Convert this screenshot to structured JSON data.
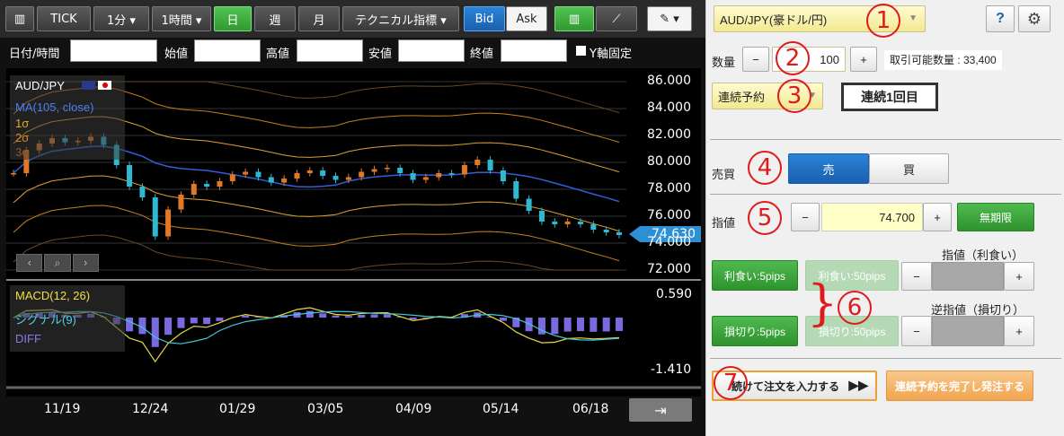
{
  "toolbar": {
    "tick": "TICK",
    "interval_1": "1分 ▾",
    "interval_2": "1時間 ▾",
    "day": "日",
    "week": "週",
    "month": "月",
    "technical": "テクニカル指標 ▾",
    "bid": "Bid",
    "ask": "Ask"
  },
  "fields": {
    "datetime": "日付/時間",
    "open": "始値",
    "high": "高値",
    "low": "安値",
    "close": "終値",
    "y_fixed": "Y軸固定"
  },
  "legend": {
    "symbol": "AUD/JPY",
    "ma": "MA(105, close)",
    "s1": "1σ",
    "s2": "2σ",
    "s3": "3σ",
    "macd": "MACD(12, 26)",
    "signal": "シグナル(9)",
    "diff": "DIFF"
  },
  "chart_data": {
    "type": "line",
    "y_ticks": [
      "86.000",
      "84.000",
      "82.000",
      "80.000",
      "78.000",
      "76.000",
      "74.000",
      "72.000"
    ],
    "macd_ticks": [
      "0.590",
      "-1.410"
    ],
    "x_ticks": [
      "11/19",
      "12/24",
      "01/29",
      "03/05",
      "04/09",
      "05/14",
      "06/18"
    ],
    "current_price": "74.630",
    "price_series": [
      79.2,
      80.9,
      81.4,
      81.8,
      81.5,
      81.6,
      81.9,
      81.3,
      79.8,
      78.2,
      77.4,
      74.5,
      76.5,
      77.6,
      78.4,
      78.2,
      78.6,
      79.1,
      79.3,
      78.9,
      78.5,
      78.8,
      79.2,
      79.4,
      79.0,
      78.7,
      78.9,
      79.3,
      79.5,
      79.6,
      79.2,
      78.7,
      78.9,
      79.2,
      79.1,
      79.8,
      80.2,
      79.4,
      78.6,
      77.3,
      76.4,
      75.6,
      75.4,
      75.6,
      75.4,
      75.0,
      74.8,
      74.6
    ]
  },
  "order": {
    "pair": "AUD/JPY(豪ドル/円)",
    "help": "?",
    "qty_label": "数量",
    "minus": "−",
    "plus": "+",
    "qty_value": "100",
    "tradable": "取引可能数量 : 33,400",
    "order_type": "連続予約",
    "sequence": "連続1回目",
    "side_label": "売買",
    "sell": "売",
    "buy": "買",
    "limit_label": "指値",
    "limit_value": "74.700",
    "expiry": "無期限",
    "tp_header": "指値（利食い）",
    "sl_header": "逆指値（損切り）",
    "tp_on": "利食い:5pips",
    "tp_off": "利食い:50pips",
    "sl_on": "損切り:5pips",
    "sl_off": "損切り:50pips",
    "continue": "続けて注文を入力する",
    "finish": "連続予約を完了し発注する",
    "n1": "1",
    "n2": "2",
    "n3": "3",
    "n4": "4",
    "n5": "5",
    "n6": "6",
    "n7": "7"
  }
}
